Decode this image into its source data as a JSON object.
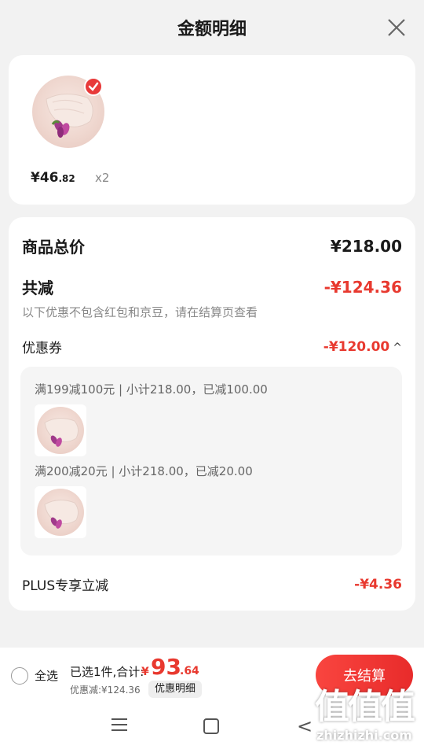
{
  "header": {
    "title": "金额明细"
  },
  "item": {
    "price_int": "¥46",
    "price_dec": ".82",
    "qty": "x2"
  },
  "breakdown": {
    "total_label": "商品总价",
    "total_value": "¥218.00",
    "reduce_label": "共减",
    "reduce_value": "-¥124.36",
    "note": "以下优惠不包含红包和京豆，请在结算页查看",
    "coupon_label": "优惠券",
    "coupon_value": "-¥120.00",
    "coupons": [
      {
        "text": "满199减100元 | 小计218.00，已减100.00"
      },
      {
        "text": "满200减20元 | 小计218.00，已减20.00"
      }
    ],
    "plus_label": "PLUS专享立减",
    "plus_value": "-¥4.36"
  },
  "footer": {
    "select_all": "全选",
    "summary": "已选1件,合计:",
    "total_sym": "¥",
    "total_int": "93",
    "total_dec": ".64",
    "discount_note": "优惠减:¥124.36",
    "detail_button": "优惠明细",
    "checkout_button": "去结算"
  },
  "watermark": {
    "main": "值值值",
    "site": "zhizhizhi.com"
  }
}
